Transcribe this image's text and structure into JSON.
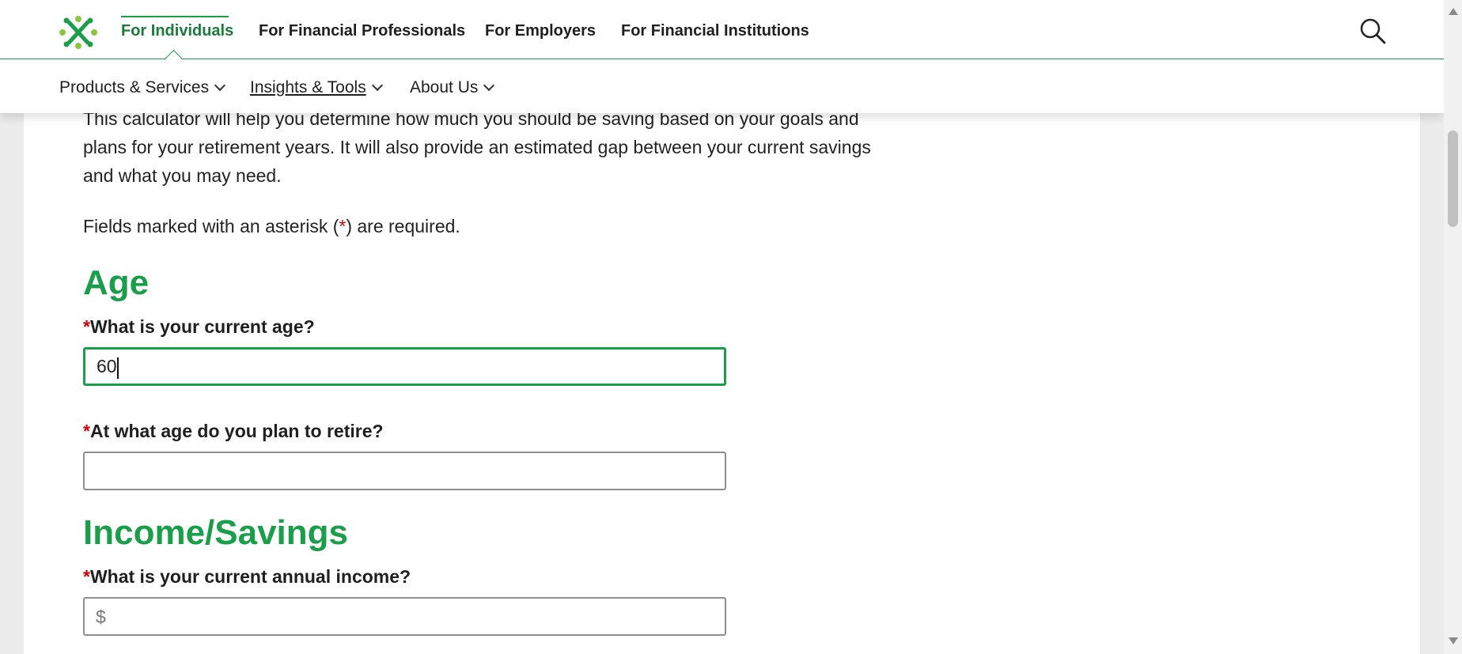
{
  "header": {
    "top_nav": [
      {
        "label": "For Individuals",
        "active": true
      },
      {
        "label": "For Financial Professionals",
        "active": false
      },
      {
        "label": "For Employers",
        "active": false
      },
      {
        "label": "For Financial Institutions",
        "active": false
      }
    ],
    "sub_nav": [
      {
        "label": "Products & Services"
      },
      {
        "label": "Insights & Tools"
      },
      {
        "label": "About Us"
      }
    ],
    "search_icon": "search-icon"
  },
  "content": {
    "intro_lines": [
      "This calculator will help you determine how much you should be saving based on your goals and",
      "plans for your retirement years. It will also provide an estimated gap between your current savings",
      "and what you may need."
    ],
    "required_note_before": "Fields marked with an asterisk (",
    "required_note_asterisk": "*",
    "required_note_after": ") are required.",
    "sections": {
      "age": {
        "heading": "Age",
        "q_current_age": "What is your current age?",
        "current_age_value": "60",
        "q_retire_age": "At what age do you plan to retire?",
        "retire_age_value": ""
      },
      "income": {
        "heading": "Income/Savings",
        "q_annual_income": "What is your current annual income?",
        "income_prefix": "$"
      }
    }
  },
  "colors": {
    "brand_green": "#1a9e49",
    "required_red": "#d40000"
  }
}
